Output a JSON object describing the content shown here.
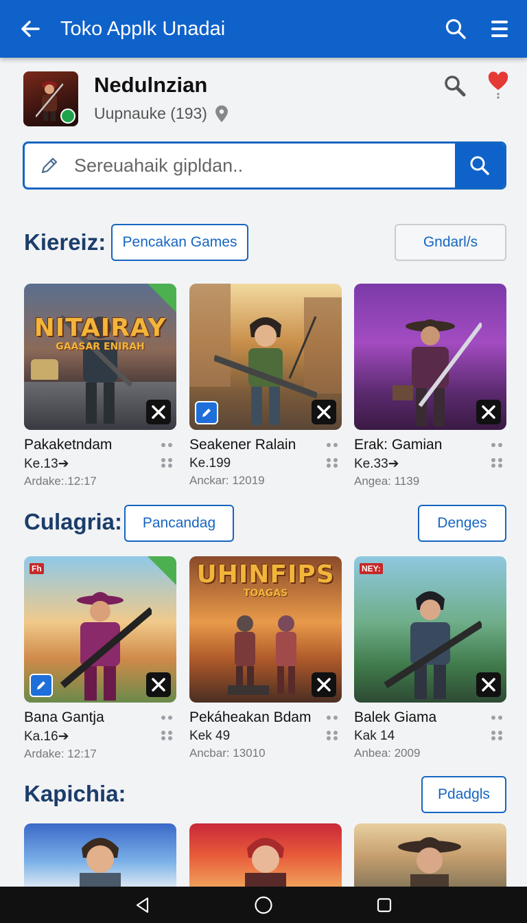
{
  "appbar": {
    "title": "Toko Applk Unadai",
    "back_icon": "arrow-left-icon",
    "search_icon": "search-icon",
    "menu_icon": "menu-icon",
    "color": "#0f62c9"
  },
  "profile": {
    "name": "Nedulnzian",
    "subtitle": "Uupnauke (193)",
    "badge_icon": "verified-badge-icon",
    "info_icon": "location-pin-icon",
    "search_icon": "search-icon",
    "favorite_icon": "heart-icon"
  },
  "search": {
    "placeholder": "Sereuahaik gipldan..",
    "edit_icon": "pencil-icon",
    "button_icon": "search-icon"
  },
  "sections": [
    {
      "title": "Kiereiz:",
      "pill_left": "Pencakan Games",
      "pill_right": "Gndarl/s",
      "cards": [
        {
          "title": "Pakaketndam",
          "price": "Ke.13➔",
          "meta": "Ardake:.12:17",
          "logo": "NITAIRAY",
          "logo_sub": "GAASAR ENIRAH",
          "badge": "x",
          "corner": true
        },
        {
          "title": "Seakener Ralain",
          "price": "Ke.199",
          "meta": "Anckar: 12019",
          "badge": "x",
          "left_badge": true
        },
        {
          "title": "Erak: Gamian",
          "price": "Ke.33➔",
          "meta": "Angea: 1139",
          "badge": "x"
        }
      ]
    },
    {
      "title": "Culagria:",
      "pill_left": "Pancandag",
      "pill_right": "Denges",
      "cards": [
        {
          "title": "Bana Gantja",
          "price": "Ka.16➔",
          "meta": "Ardake: 12:17",
          "badge": "x",
          "left_badge": true,
          "corner": true,
          "tag": "Fh"
        },
        {
          "title": "Pekáheakan Bdam",
          "price": "Kek 49",
          "meta": "Ancbar: 13010",
          "logo": "UHINFIPS",
          "logo_sub": "TOAGAS",
          "badge": "x"
        },
        {
          "title": "Balek Giama",
          "price": "Kak 14",
          "meta": "Anbea: 2009",
          "badge": "x",
          "tag": "NEY:"
        }
      ]
    },
    {
      "title": "Kapichia:",
      "pill_right": "Pdadgls"
    }
  ],
  "navbar": {
    "back_icon": "nav-back-icon",
    "home_icon": "nav-home-icon",
    "recents_icon": "nav-recents-icon"
  }
}
